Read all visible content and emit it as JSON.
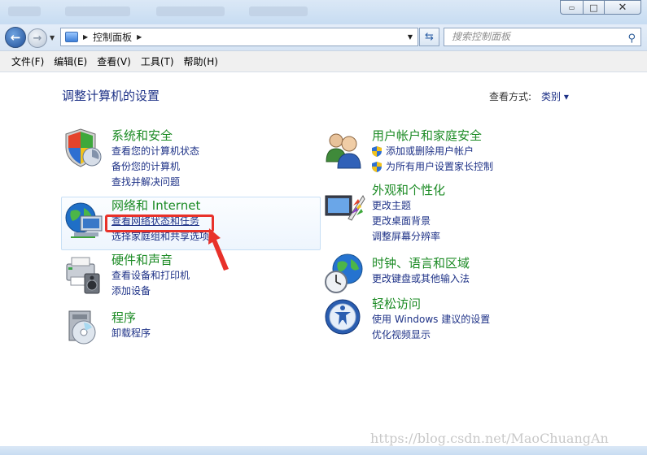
{
  "window": {
    "minimize_glyph": "▭",
    "maximize_glyph": "□",
    "close_glyph": "✕"
  },
  "addressbar": {
    "breadcrumb": "控制面板",
    "search_placeholder": "搜索控制面板"
  },
  "menu": [
    "文件(F)",
    "编辑(E)",
    "查看(V)",
    "工具(T)",
    "帮助(H)"
  ],
  "page": {
    "title": "调整计算机的设置",
    "view_label": "查看方式:",
    "view_value": "类别 ▾"
  },
  "categories": {
    "system": {
      "title": "系统和安全",
      "links": [
        "查看您的计算机状态",
        "备份您的计算机",
        "查找并解决问题"
      ]
    },
    "network": {
      "title": "网络和 Internet",
      "links": [
        "查看网络状态和任务",
        "选择家庭组和共享选项"
      ]
    },
    "hardware": {
      "title": "硬件和声音",
      "links": [
        "查看设备和打印机",
        "添加设备"
      ]
    },
    "programs": {
      "title": "程序",
      "links": [
        "卸载程序"
      ]
    },
    "users": {
      "title": "用户帐户和家庭安全",
      "links": [
        "添加或删除用户帐户",
        "为所有用户设置家长控制"
      ]
    },
    "appearance": {
      "title": "外观和个性化",
      "links": [
        "更改主题",
        "更改桌面背景",
        "调整屏幕分辨率"
      ]
    },
    "clock": {
      "title": "时钟、语言和区域",
      "links": [
        "更改键盘或其他输入法"
      ]
    },
    "access": {
      "title": "轻松访问",
      "links": [
        "使用 Windows 建议的设置",
        "优化视频显示"
      ]
    }
  },
  "watermark": "https://blog.csdn.net/MaoChuangAn",
  "colors": {
    "link": "#1e3287",
    "category_title": "#1c8b25",
    "annotation": "#e8312a"
  }
}
